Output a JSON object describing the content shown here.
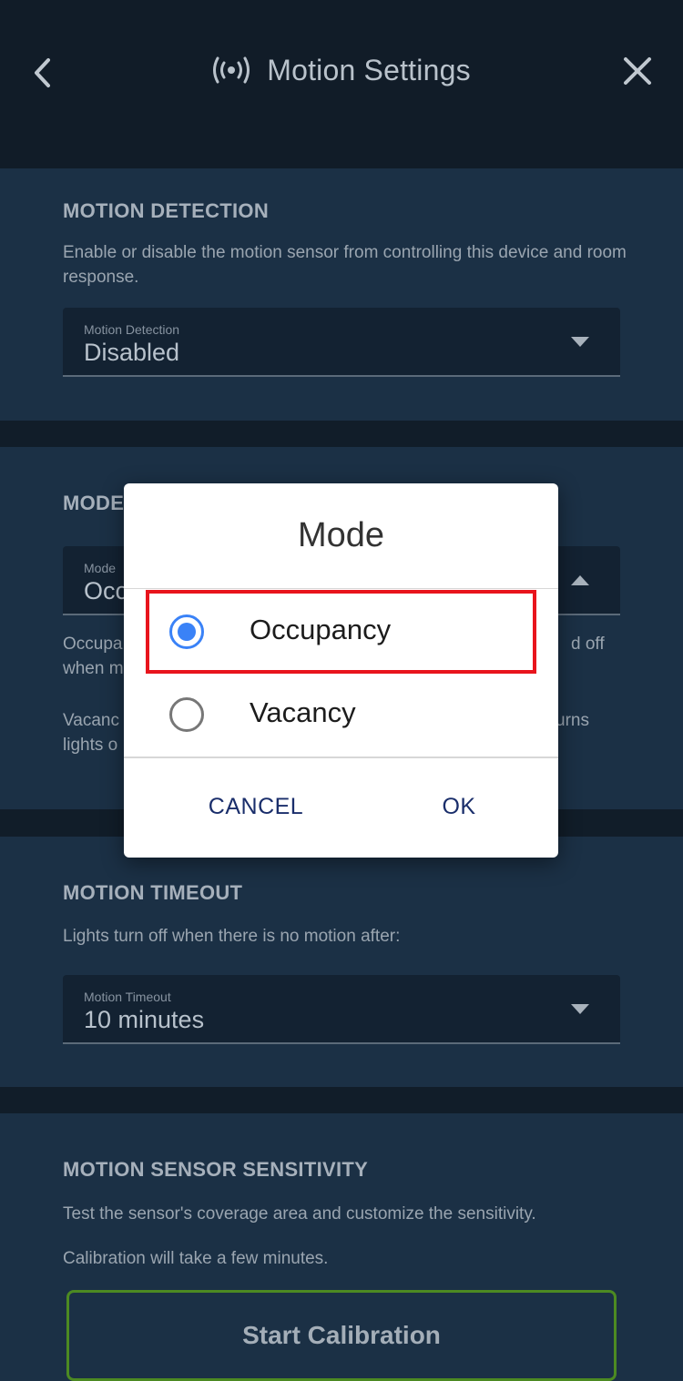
{
  "header": {
    "title": "Motion Settings",
    "icons": {
      "back": "chevron-left-icon",
      "sensor": "motion-sensor-icon",
      "close": "close-icon"
    }
  },
  "motion_detection": {
    "title": "MOTION DETECTION",
    "description": "Enable or disable the motion sensor from controlling this device and room response.",
    "field_label": "Motion Detection",
    "field_value": "Disabled"
  },
  "mode_section": {
    "title_visible": "MODE",
    "field_label": "Mode",
    "field_value_visible": "Occ",
    "desc1_left": "Occupa",
    "desc1_left2": "when m",
    "desc1_right": "d off",
    "desc2_left": "Vacanc",
    "desc2_left2": "lights o",
    "desc2_right": "urns"
  },
  "motion_timeout": {
    "title": "MOTION TIMEOUT",
    "description": "Lights turn off when there is no motion after:",
    "field_label": "Motion Timeout",
    "field_value": "10 minutes"
  },
  "sensitivity": {
    "title": "MOTION SENSOR SENSITIVITY",
    "description1": "Test the sensor's coverage area and customize the sensitivity.",
    "description2": "Calibration will take a few minutes.",
    "button_label": "Start Calibration"
  },
  "dialog": {
    "title": "Mode",
    "options": [
      {
        "label": "Occupancy",
        "selected": true
      },
      {
        "label": "Vacancy",
        "selected": false
      }
    ],
    "cancel_label": "CANCEL",
    "ok_label": "OK"
  },
  "colors": {
    "accent_radio": "#3a82f7",
    "highlight_border": "#e8141c",
    "calibration_border": "#4c8a22",
    "dialog_button_text": "#1a2e6b"
  }
}
